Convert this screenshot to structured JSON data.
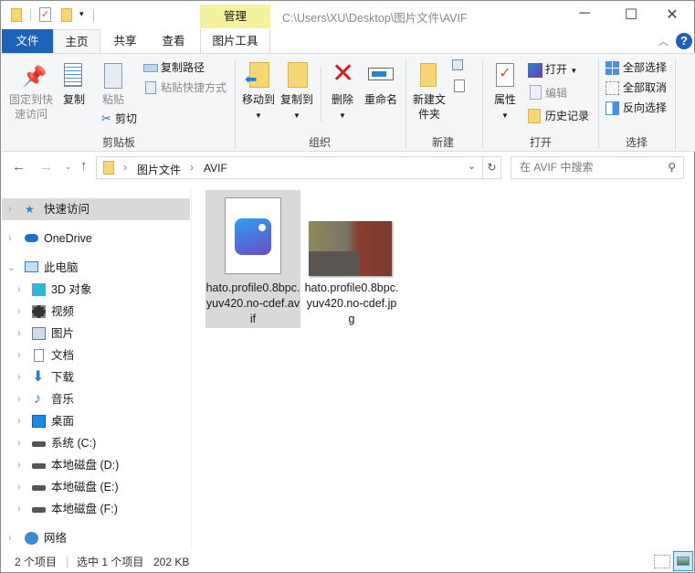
{
  "titlebar": {
    "path": "C:\\Users\\XU\\Desktop\\图片文件\\AVIF",
    "context_tab": "管理",
    "minimize": "─",
    "maximize": "☐",
    "close": "✕"
  },
  "tabs": [
    {
      "label": "文件"
    },
    {
      "label": "主页"
    },
    {
      "label": "共享"
    },
    {
      "label": "查看"
    },
    {
      "label": "图片工具"
    }
  ],
  "ribbon": {
    "clipboard": {
      "label": "剪贴板",
      "pin": "固定到快速访问",
      "copy": "复制",
      "paste": "粘贴",
      "copy_path": "复制路径",
      "paste_shortcut": "粘贴快捷方式",
      "cut": "剪切"
    },
    "organize": {
      "label": "组织",
      "move_to": "移动到",
      "copy_to": "复制到",
      "delete": "删除",
      "rename": "重命名"
    },
    "new": {
      "label": "新建",
      "new_folder": "新建文件夹"
    },
    "open": {
      "label": "打开",
      "properties": "属性",
      "open": "打开",
      "edit": "编辑",
      "history": "历史记录"
    },
    "select": {
      "label": "选择",
      "select_all": "全部选择",
      "select_none": "全部取消",
      "invert": "反向选择"
    }
  },
  "address": {
    "crumbs": [
      "图片文件",
      "AVIF"
    ],
    "search_placeholder": "在 AVIF 中搜索"
  },
  "nav": {
    "items": [
      {
        "label": "快速访问"
      },
      {
        "label": "OneDrive"
      },
      {
        "label": "此电脑"
      },
      {
        "label": "3D 对象"
      },
      {
        "label": "视频"
      },
      {
        "label": "图片"
      },
      {
        "label": "文档"
      },
      {
        "label": "下载"
      },
      {
        "label": "音乐"
      },
      {
        "label": "桌面"
      },
      {
        "label": "系统 (C:)"
      },
      {
        "label": "本地磁盘 (D:)"
      },
      {
        "label": "本地磁盘 (E:)"
      },
      {
        "label": "本地磁盘 (F:)"
      },
      {
        "label": "网络"
      }
    ]
  },
  "files": [
    {
      "name": "hato.profile0.8bpc.yuv420.no-cdef.avif",
      "selected": true
    },
    {
      "name": "hato.profile0.8bpc.yuv420.no-cdef.jpg",
      "selected": false
    }
  ],
  "status": {
    "count": "2 个项目",
    "selected": "选中 1 个项目",
    "size": "202 KB"
  },
  "colors": {
    "file_tab": "#1c63b7",
    "manage_tab": "#f4f29a",
    "selection": "#d9d9d9"
  }
}
